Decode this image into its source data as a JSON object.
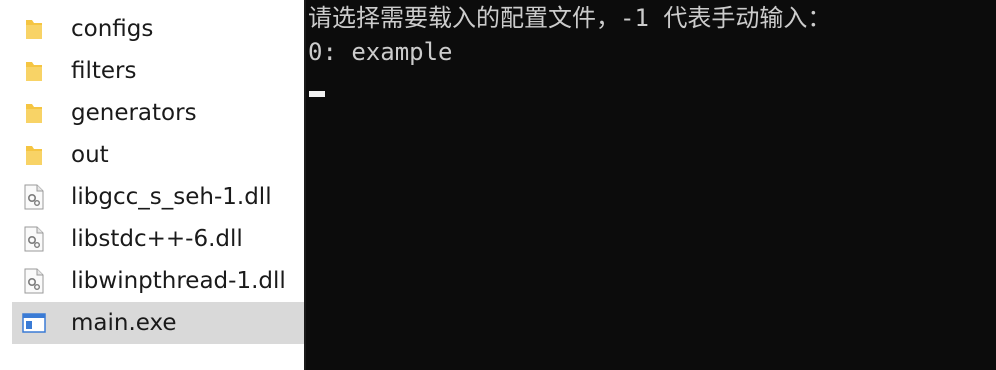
{
  "explorer": {
    "items": [
      {
        "label": "configs",
        "icon": "folder-icon"
      },
      {
        "label": "filters",
        "icon": "folder-icon"
      },
      {
        "label": "generators",
        "icon": "folder-icon"
      },
      {
        "label": "out",
        "icon": "folder-icon"
      },
      {
        "label": "libgcc_s_seh-1.dll",
        "icon": "dll-file-icon"
      },
      {
        "label": "libstdc++-6.dll",
        "icon": "dll-file-icon"
      },
      {
        "label": "libwinpthread-1.dll",
        "icon": "dll-file-icon"
      },
      {
        "label": "main.exe",
        "icon": "exe-file-icon",
        "selected": true
      }
    ]
  },
  "console": {
    "prompt_line": "请选择需要载入的配置文件，-1 代表手动输入：",
    "option_line": "0: example"
  },
  "colors": {
    "console_bg": "#0c0c0c",
    "console_text": "#cccccc",
    "folder": "#f5c542",
    "selected_row": "#d9d9d9"
  }
}
